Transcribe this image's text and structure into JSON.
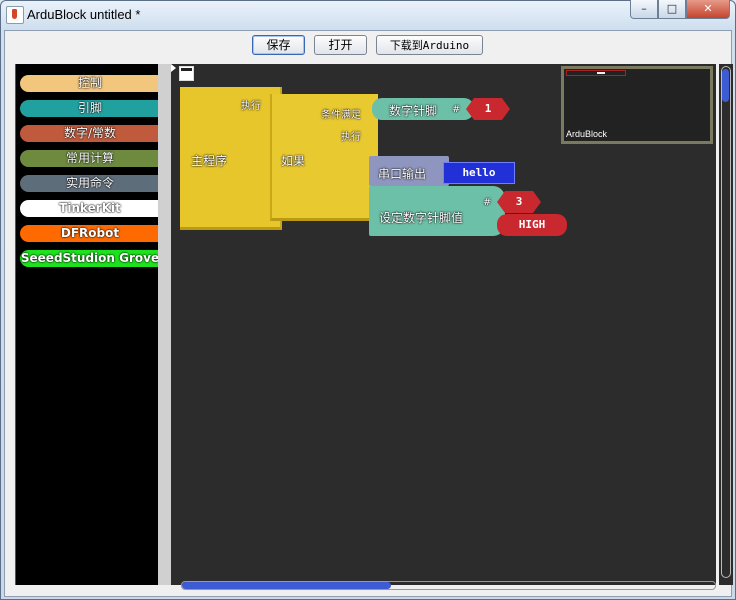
{
  "window": {
    "title": "ArduBlock untitled *",
    "controls": [
      "minimize",
      "maximize",
      "close"
    ]
  },
  "toolbar": {
    "save_label": "保存",
    "open_label": "打开",
    "upload_label": "下载到Arduino"
  },
  "palette": {
    "items": [
      {
        "label": "控制",
        "color": "#f5c87e"
      },
      {
        "label": "引脚",
        "color": "#1f9b9b"
      },
      {
        "label": "数字/常数",
        "color": "#c25a3a"
      },
      {
        "label": "常用计算",
        "color": "#6f8c3e"
      },
      {
        "label": "实用命令",
        "color": "#5b6b78"
      },
      {
        "label": "TinkerKit",
        "color": "#ffffff"
      },
      {
        "label": "DFRobot",
        "color": "#ff6600"
      },
      {
        "label": "SeeedStudion Grove",
        "color": "#00ee00"
      }
    ]
  },
  "workspace": {
    "minimap_label": "ArduBlock",
    "blocks": {
      "main_program": {
        "label": "主程序",
        "do_label": "执行",
        "color": "#e9c930"
      },
      "if_block": {
        "label": "如果",
        "condition_label": "条件满足",
        "do_label": "执行",
        "color": "#e9c930"
      },
      "digital_read": {
        "label": "数字针脚",
        "pin_symbol": "#",
        "pin_value": "1",
        "color": "#6cc0a8"
      },
      "serial_print": {
        "label": "串口输出",
        "text_value": "hello",
        "color": "#8e96c0"
      },
      "digital_write": {
        "label": "设定数字针脚值",
        "pin_symbol": "#",
        "pin_value": "3",
        "state_value": "HIGH",
        "color": "#6cc0a8"
      }
    }
  }
}
